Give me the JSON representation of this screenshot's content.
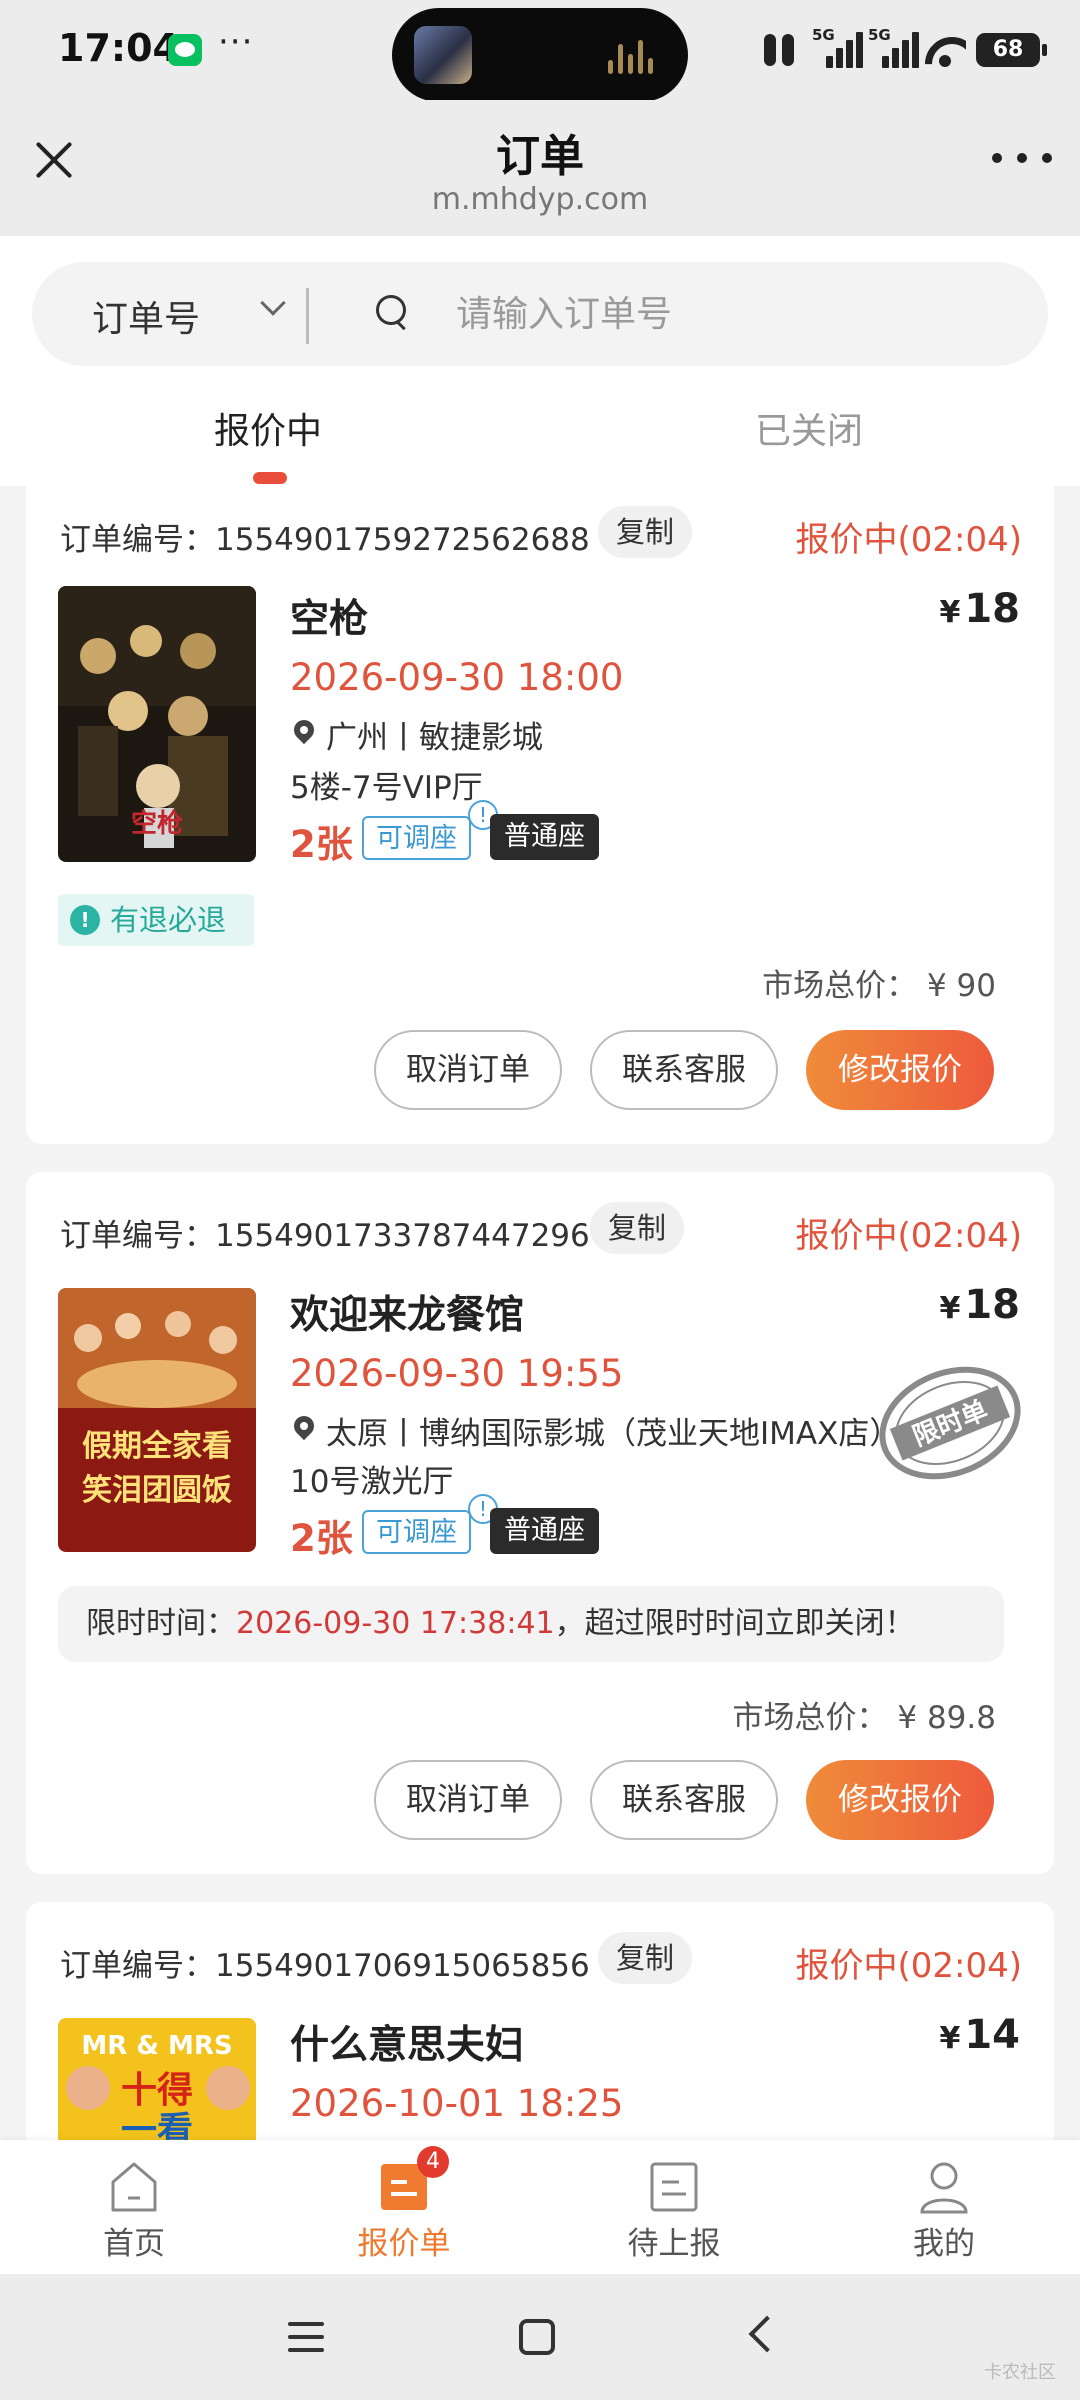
{
  "status_bar": {
    "time": "17:04",
    "battery": "68",
    "network_1": "5G",
    "network_2": "5G"
  },
  "header": {
    "title": "订单",
    "url": "m.mhdyp.com"
  },
  "search": {
    "type_label": "订单号",
    "placeholder": "请输入订单号",
    "value": ""
  },
  "tabs": [
    {
      "label": "报价中",
      "active": true
    },
    {
      "label": "已关闭",
      "active": false
    }
  ],
  "orders": [
    {
      "order_label": "订单编号：1554901759272562688",
      "copy_label": "复制",
      "status": "报价中(02:04)",
      "movie": "空枪",
      "price_symbol": "¥",
      "price": "18",
      "time": "2026-09-30 18:00",
      "venue": "广州丨敏捷影城",
      "hall": "5楼-7号VIP厅",
      "count": "2张",
      "adjust_label": "可调座",
      "adjust_info": "!",
      "seat_label": "普通座",
      "refund_label": "有退必退",
      "market_price": "市场总价： ¥ 90",
      "buttons": {
        "cancel": "取消订单",
        "service": "联系客服",
        "modify": "修改报价"
      }
    },
    {
      "order_label": "订单编号：1554901733787447296",
      "copy_label": "复制",
      "status": "报价中(02:04)",
      "movie": "欢迎来龙餐馆",
      "price_symbol": "¥",
      "price": "18",
      "time": "2026-09-30 19:55",
      "venue": "太原丨博纳国际影城（茂业天地IMAX店）",
      "hall": "10号激光厅",
      "count": "2张",
      "adjust_label": "可调座",
      "adjust_info": "!",
      "seat_label": "普通座",
      "stamp_label": "限时单",
      "limit_prefix": "限时时间：",
      "limit_time": "2026-09-30 17:38:41",
      "limit_suffix": "，超过限时时间立即关闭！",
      "poster_text_line1": "假期全家看",
      "poster_text_line2": "笑泪团圆饭",
      "market_price": "市场总价： ¥ 89.8",
      "buttons": {
        "cancel": "取消订单",
        "service": "联系客服",
        "modify": "修改报价"
      }
    },
    {
      "order_label": "订单编号：1554901706915065856",
      "copy_label": "复制",
      "status": "报价中(02:04)",
      "movie": "什么意思夫妇",
      "price_symbol": "¥",
      "price": "14",
      "time": "2026-10-01 18:25",
      "poster_text_top": "MR & MRS",
      "poster_text_line1": "十得",
      "poster_text_line2": "一看"
    }
  ],
  "bottom_nav": [
    {
      "label": "首页",
      "icon": "home-icon"
    },
    {
      "label": "报价单",
      "icon": "quote-list-icon",
      "badge": "4",
      "active": true
    },
    {
      "label": "待上报",
      "icon": "pending-report-icon"
    },
    {
      "label": "我的",
      "icon": "profile-icon"
    }
  ],
  "watermark": "卡农社区",
  "colors": {
    "accent_red": "#e0533d",
    "accent_orange": "#ee7a30",
    "refund_green": "#27a99a",
    "adjust_blue": "#3a98d2"
  }
}
